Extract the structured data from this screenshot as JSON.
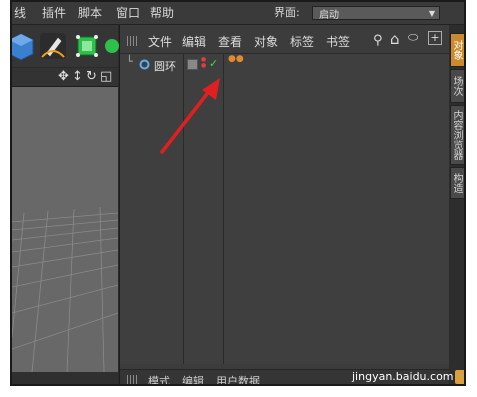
{
  "app_menu": [
    "线",
    "插件",
    "脚本",
    "窗口",
    "帮助"
  ],
  "layout": {
    "label": "界面:",
    "value": "启动"
  },
  "object_manager": {
    "menu": [
      "文件",
      "编辑",
      "查看",
      "对象",
      "标签",
      "书签"
    ],
    "objects": [
      {
        "name": "圆环"
      }
    ],
    "footer_menu": [
      "模式",
      "编辑",
      "用户数据"
    ]
  },
  "right_tabs": [
    "对象",
    "场次",
    "内容浏览器",
    "构造"
  ],
  "watermark": "jingyan.baidu.com",
  "colors": {
    "accent": "#cc8a2e",
    "arrow": "#e02020",
    "panel": "#3c3c3c"
  }
}
